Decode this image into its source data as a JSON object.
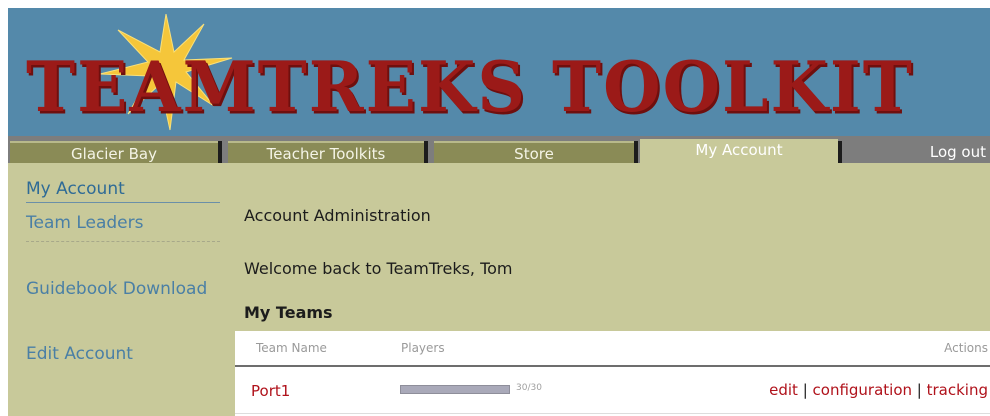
{
  "brand": {
    "logo_text": "TEAMTREKS TOOLKIT",
    "colors": {
      "header_bg": "#5489aa",
      "logo_red": "#9b1a18",
      "content_bg": "#c8c99a",
      "tab_bg": "#8a8b56",
      "link_red": "#b0121b"
    }
  },
  "nav": {
    "tabs": [
      {
        "label": "Glacier Bay",
        "active": false
      },
      {
        "label": "Teacher Toolkits",
        "active": false
      },
      {
        "label": "Store",
        "active": false
      },
      {
        "label": "My Account",
        "active": true
      }
    ],
    "logout": "Log out"
  },
  "sidebar": {
    "items": [
      {
        "label": "My Account",
        "active": true
      },
      {
        "label": "Team Leaders",
        "active": false
      },
      {
        "label": "Guidebook Download",
        "active": false
      },
      {
        "label": "Edit Account",
        "active": false
      }
    ]
  },
  "main": {
    "title": "Account Administration",
    "welcome": "Welcome back to TeamTreks, Tom",
    "teams_title": "My Teams",
    "table": {
      "headers": {
        "team_name": "Team Name",
        "players": "Players",
        "actions": "Actions"
      },
      "rows": [
        {
          "team_name": "Port1",
          "players_text": "30/30",
          "players_fraction": 1.0,
          "actions": {
            "edit": "edit",
            "configuration": "configuration",
            "tracking": "tracking",
            "separator": "|"
          }
        }
      ]
    }
  }
}
